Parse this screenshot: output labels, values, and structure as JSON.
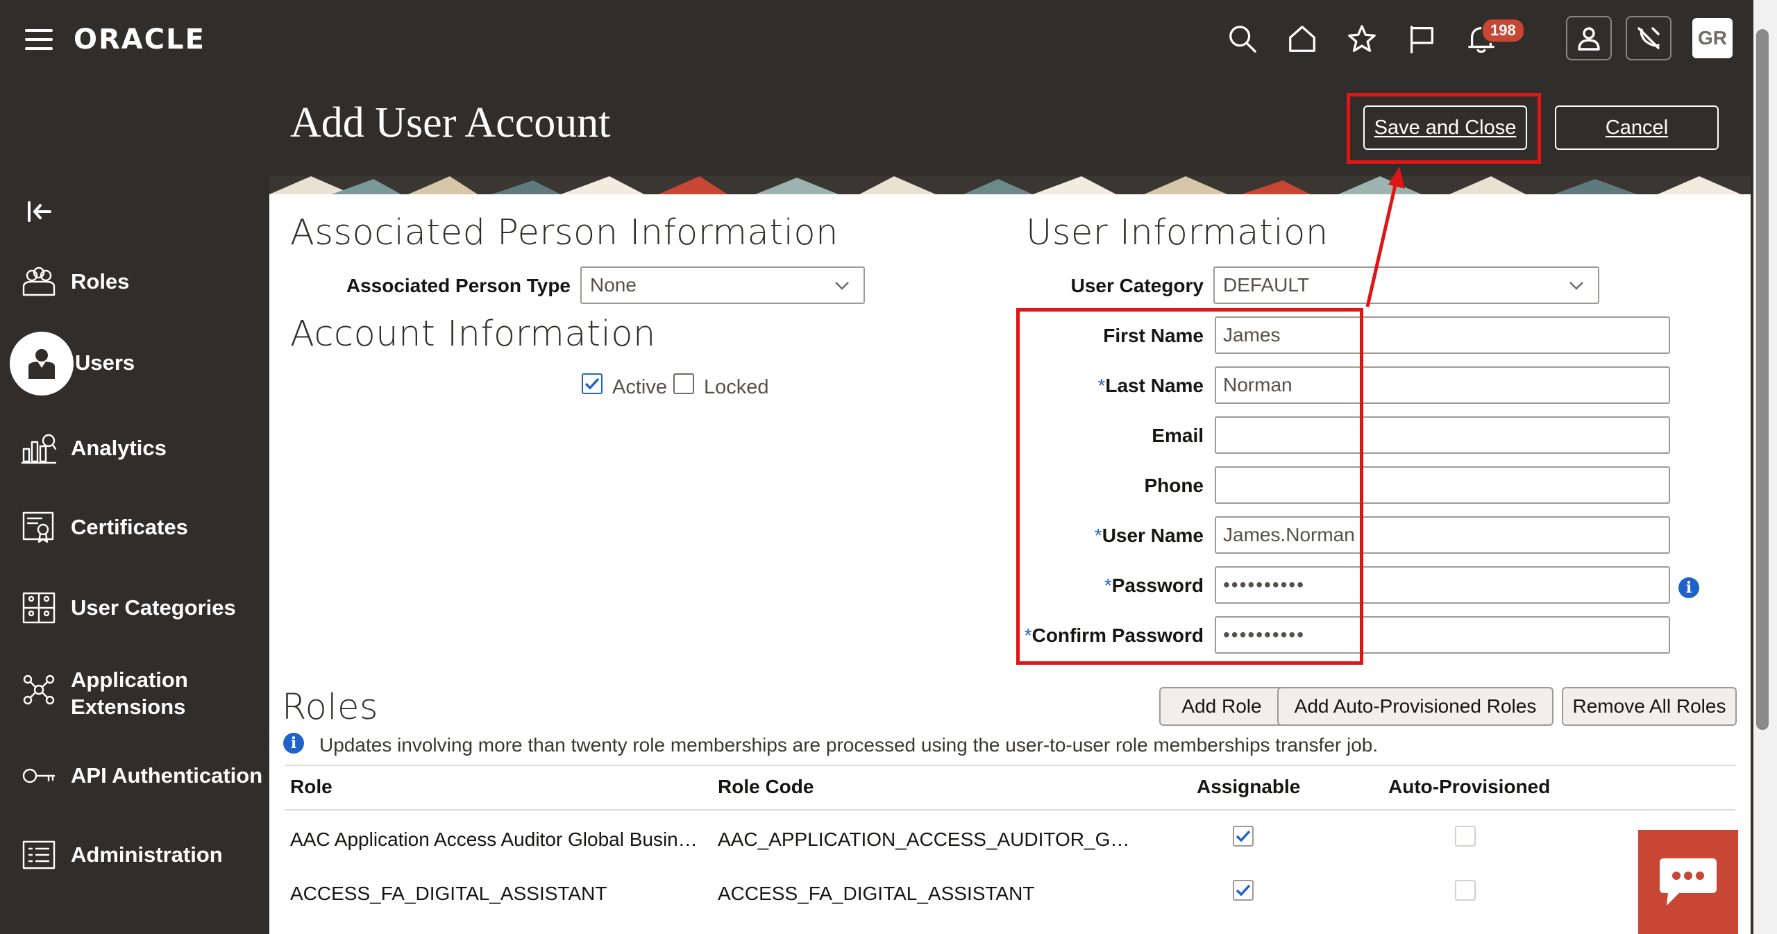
{
  "header": {
    "logo": "ORACLE",
    "notifications_count": "198",
    "avatar_initials": "GR"
  },
  "page": {
    "title": "Add User Account",
    "save_close_label": "Save and Close",
    "cancel_label": "Cancel"
  },
  "nav": {
    "items": [
      {
        "label": "Roles",
        "icon": "roles-icon"
      },
      {
        "label": "Users",
        "icon": "users-icon"
      },
      {
        "label": "Analytics",
        "icon": "analytics-icon"
      },
      {
        "label": "Certificates",
        "icon": "certificates-icon"
      },
      {
        "label": "User Categories",
        "icon": "user-categories-icon"
      },
      {
        "label": "Application",
        "label2": "Extensions",
        "icon": "application-extensions-icon"
      },
      {
        "label": "API Authentication",
        "icon": "api-authentication-icon"
      },
      {
        "label": "Administration",
        "icon": "administration-icon"
      }
    ]
  },
  "associated": {
    "title": "Associated Person Information",
    "type_label": "Associated Person Type",
    "type_value": "None"
  },
  "account": {
    "title": "Account Information",
    "active_label": "Active",
    "active_checked": true,
    "locked_label": "Locked",
    "locked_checked": false
  },
  "user_info": {
    "title": "User Information",
    "category_label": "User Category",
    "category_value": "DEFAULT",
    "first_name_label": "First Name",
    "first_name_value": "James",
    "last_name_label": "Last Name",
    "last_name_value": "Norman",
    "email_label": "Email",
    "email_value": "",
    "phone_label": "Phone",
    "phone_value": "",
    "username_label": "User Name",
    "username_value": "James.Norman",
    "password_label": "Password",
    "password_value": "••••••••••",
    "confirm_label": "Confirm Password",
    "confirm_value": "••••••••••",
    "required_mark": "*"
  },
  "roles": {
    "title": "Roles",
    "add_role_label": "Add Role",
    "add_auto_label": "Add Auto-Provisioned Roles",
    "remove_all_label": "Remove All Roles",
    "info_text": "Updates involving more than twenty role memberships are processed using the user-to-user role memberships transfer job.",
    "columns": [
      "Role",
      "Role Code",
      "Assignable",
      "Auto-Provisioned"
    ],
    "rows": [
      {
        "role": "AAC Application Access Auditor Global Busin…",
        "code": "AAC_APPLICATION_ACCESS_AUDITOR_G…",
        "assignable": true,
        "auto": false
      },
      {
        "role": "ACCESS_FA_DIGITAL_ASSISTANT",
        "code": "ACCESS_FA_DIGITAL_ASSISTANT",
        "assignable": true,
        "auto": false
      }
    ]
  },
  "colors": {
    "header_bg": "#312d2a",
    "accent_red": "#c74634",
    "annotation_red": "#e01515",
    "link_blue": "#1e64c8"
  }
}
